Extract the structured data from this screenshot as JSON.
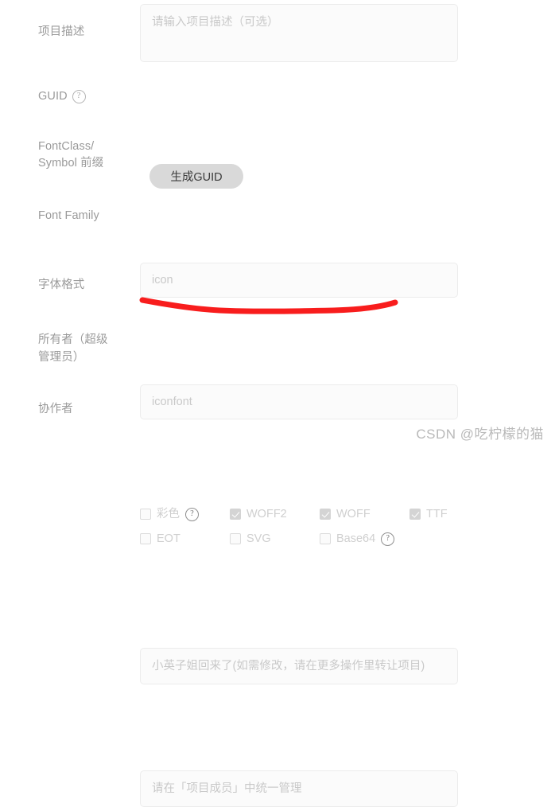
{
  "form": {
    "rows": [
      {
        "key": "description",
        "label": "项目描述",
        "placeholder": "请输入项目描述（可选）"
      },
      {
        "key": "guid",
        "label": "GUID",
        "help": "?",
        "button_label": "生成GUID"
      },
      {
        "key": "fontclass",
        "label": "FontClass/\nSymbol 前缀",
        "label_line1": "FontClass/",
        "label_line2": "Symbol 前缀",
        "placeholder": "icon"
      },
      {
        "key": "fontfamily",
        "label": "Font Family",
        "placeholder": "iconfont"
      },
      {
        "key": "formats",
        "label": "字体格式"
      },
      {
        "key": "owner",
        "label": "所有者（超级管理员）",
        "label_line1": "所有者（超级",
        "label_line2": "管理员）",
        "placeholder": "小英子姐回来了(如需修改，请在更多操作里转让项目)"
      },
      {
        "key": "collaborator",
        "label": "协作者",
        "placeholder": "请在「项目成员」中统一管理"
      }
    ]
  },
  "font_formats": {
    "line1": [
      {
        "label": "彩色",
        "checked": false,
        "help": "?"
      },
      {
        "label": "WOFF2",
        "checked": true
      },
      {
        "label": "WOFF",
        "checked": true
      },
      {
        "label": "TTF",
        "checked": true
      }
    ],
    "line2": [
      {
        "label": "EOT",
        "checked": false
      },
      {
        "label": "SVG",
        "checked": false
      },
      {
        "label": "Base64",
        "checked": false,
        "help": "?"
      }
    ]
  },
  "annotation": {
    "color": "#f81d1d",
    "type": "hand-drawn-underline"
  },
  "watermark": {
    "text": "CSDN @吃柠檬的猫",
    "color": "#b9b9b9"
  },
  "colors": {
    "label": "#9a9a9a",
    "placeholder": "#c9c9c9",
    "field_bg": "#fbfbfb",
    "field_border": "#ececec",
    "button_bg": "#d9d9d9",
    "checkbox_checked": "#d4d4d4",
    "annotation_red": "#f81d1d"
  }
}
